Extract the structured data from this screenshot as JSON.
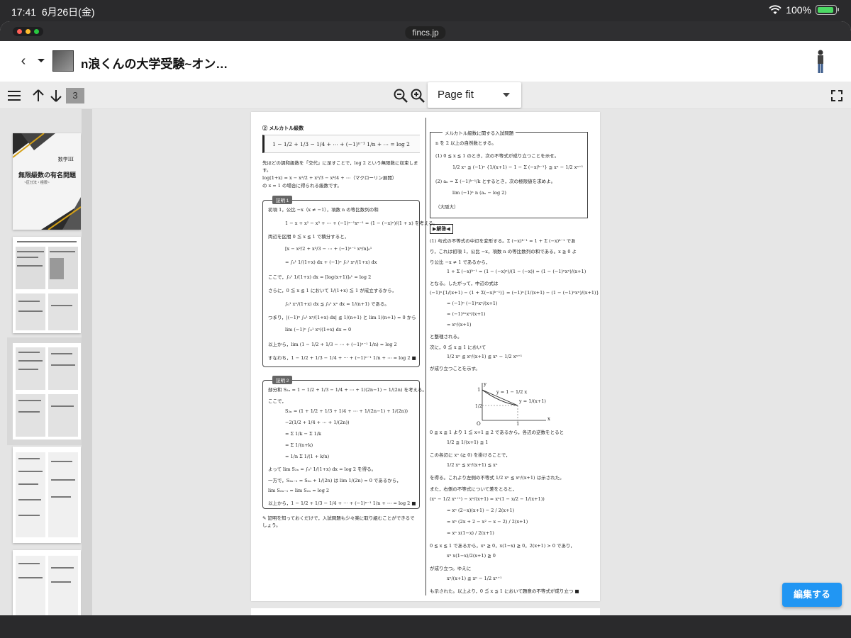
{
  "statusbar": {
    "time": "17:41",
    "date": "6月26日(金)",
    "battery": "100%",
    "battery_level": 1.0,
    "icons": [
      "wifi-icon",
      "battery-icon"
    ]
  },
  "browser": {
    "url": "fincs.jp",
    "traffic_colors": [
      "#ff5f57",
      "#febc2e",
      "#28c840"
    ]
  },
  "appbar": {
    "title": "n浪くんの大学受験~オン…",
    "icons": [
      "back-icon",
      "dropdown-icon",
      "document-thumbnail",
      "user-avatar-icon"
    ]
  },
  "toolbar": {
    "page_number": "3",
    "zoom": {
      "selected": "Page fit"
    },
    "icons": [
      "menu-icon",
      "arrow-up-icon",
      "arrow-down-icon",
      "zoom-out-icon",
      "zoom-in-icon",
      "fullscreen-icon"
    ]
  },
  "cover": {
    "subject": "数学III",
    "title": "無限級数の有名問題",
    "subtitle": "~区分法・極限~"
  },
  "page": {
    "sec_title": "② メルカトル級数",
    "main_formula": "1 − 1/2 + 1/3 − 1/4 + ⋯ + (−1)ⁿ⁻¹ 1/n + ⋯ = log 2",
    "intro_1": "先ほどの調和級数を「交代」に足すことで，log 2 という無限数に収束しま",
    "intro_2": "す。",
    "intro_3": "log(1+x) = x − x²/2 + x³/3 − x⁴/4 + ⋯（マクローリン展開）",
    "intro_4": "の x = 1 の場合に得られる級数です。",
    "proof1_tag": "証明 1",
    "proof1_lines": [
      "初項 1，公比 −x（x ≠ −1），項数 n の等比数列の和",
      "1 − x + x² − x³ + ⋯ + (−1)ⁿ⁻¹xⁿ⁻¹ = (1 − (−x)ⁿ)/(1 + x) を考える。",
      "両辺を区間 0 ≦ x ≦ 1 で積分すると，",
      "[x − x²/2 + x³/3 − ⋯ + (−1)ⁿ⁻¹ xⁿ/n]₀¹",
      "= ∫₀¹ 1/(1+x) dx + (−1)ⁿ ∫₀¹ xⁿ/(1+x) dx",
      "ここで，∫₀¹ 1/(1+x) dx = [log(x+1)]₀¹ = log 2",
      "さらに，0 ≦ x ≦ 1 において 1/(1+x) ≦ 1 が成立するから，",
      "∫₀¹ xⁿ/(1+x) dx ≦ ∫₀¹ xⁿ dx = 1/(n+1) である。",
      "つまり，|(−1)ⁿ ∫₀¹ xⁿ/(1+x) dx| ≦ 1/(n+1) と lim 1/(n+1) = 0 から",
      "lim (−1)ⁿ ∫₀¹ xⁿ/(1+x) dx = 0",
      "以上から，lim (1 − 1/2 + 1/3 − ⋯ + (−1)ⁿ⁻¹ 1/n) = log 2",
      "すなわち，1 − 1/2 + 1/3 − 1/4 + ⋯ + (−1)ⁿ⁻¹ 1/n + ⋯ = log 2 ■"
    ],
    "proof2_tag": "証明 2",
    "proof2_lines": [
      "部分和 S₂ₙ = 1 − 1/2 + 1/3 − 1/4 + ⋯ + 1/(2n−1) − 1/(2n) を考える。",
      "ここで，",
      "S₂ₙ = (1 + 1/2 + 1/3 + 1/4 + ⋯ + 1/(2n−1) + 1/(2n))",
      "−2(1/2 + 1/4 + ⋯ + 1/(2n))",
      "= Σ 1/k − Σ 1/k",
      "= Σ 1/(n+k)",
      "= 1/n Σ 1/(1 + k/n)",
      "よって lim S₂ₙ = ∫₀¹ 1/(1+x) dx = log 2 を得る。",
      "一方で，S₂ₙ₋₁ = S₂ₙ + 1/(2n) は lim 1/(2n) = 0 であるから，",
      "lim S₂ₙ₋₁ = lim S₂ₙ = log 2",
      "以上から，1 − 1/2 + 1/3 − 1/4 + ⋯ + (−1)ⁿ⁻¹ 1/n + ⋯ = log 2 ■"
    ],
    "footnote": "✎ 証明を知っておくだけで，入試問題も少々楽に取り組むことができるで",
    "footnote_2": "しょう。",
    "exam_title": "メルカトル級数に関する入試問題",
    "exam_lines": [
      "n を 2 以上の自然数とする。",
      "(1) 0 ≦ x ≦ 1 のとき，次の不等式が成り立つことを示せ。",
      "1/2 xⁿ ≦ (−1)ⁿ {1/(x+1) − 1 − Σ (−x)ᵏ⁻¹} ≦ xⁿ − 1/2 xⁿ⁺¹",
      "(2) aₙ = Σ (−1)ᵏ⁻¹/k とするとき，次の極限値を求めよ。",
      "lim (−1)ⁿ n (aₙ − log 2)",
      "（大阪大）"
    ],
    "answer_tag": "▶解答◀",
    "answer_lines": [
      "(1) 与式の不等式の中辺を変形する。Σ (−x)ᵏ⁻¹ = 1 + Σ (−x)ᵏ⁻¹ であ",
      "り，これは初項 1，公比 −x，項数 n の等比数列の和である。x ≧ 0 よ",
      "り公比 −x ≠ 1 であるから，",
      "1 + Σ (−x)ᵏ⁻¹ = (1 − (−x)ⁿ)/(1 − (−x)) = (1 − (−1)ⁿxⁿ)/(x+1)",
      "となる。したがって，中辺の式は",
      "(−1)ⁿ{1/(x+1) − (1 + Σ(−x)ᵏ⁻¹)} = (−1)ⁿ{1/(x+1) − (1 − (−1)ⁿxⁿ)/(x+1)}",
      "= (−1)ⁿ (−1)ⁿxⁿ/(x+1)",
      "= (−1)²ⁿxⁿ/(x+1)",
      "= xⁿ/(x+1)",
      "と整理される。",
      "次に，0 ≦ x ≦ 1 において",
      "1/2 xⁿ ≦ xⁿ/(x+1) ≦ xⁿ − 1/2 xⁿ⁺¹",
      "が成り立つことを示す。"
    ],
    "graph_labels": {
      "y": "y",
      "x": "x",
      "o": "O",
      "one_x": "1",
      "one_y": "1",
      "half": "1/2",
      "line": "y = 1 − 1/2 x",
      "curve": "y = 1/(x+1)"
    },
    "answer_lines_2": [
      "0 ≦ x ≦ 1 より 1 ≦ x+1 ≦ 2 であるから，各辺の逆数をとると",
      "1/2 ≦ 1/(x+1) ≦ 1",
      "この各辺に xⁿ (≧ 0) を掛けることで，",
      "1/2 xⁿ ≦ xⁿ/(x+1) ≦ xⁿ",
      "を得る。これより左側の不等式 1/2 xⁿ ≦ xⁿ/(x+1) は示された。",
      "また，右側の不等式について差をとると，",
      "(xⁿ − 1/2 xⁿ⁺¹) − xⁿ/(x+1) = xⁿ(1 − x/2 − 1/(x+1))",
      "= xⁿ (2−x)(x+1) − 2 / 2(x+1)",
      "= xⁿ (2x + 2 − x² − x − 2) / 2(x+1)",
      "= xⁿ x(1−x) / 2(x+1)",
      "0 ≦ x ≦ 1 であるから，xⁿ ≧ 0，x(1−x) ≧ 0，2(x+1) > 0 であり，",
      "xⁿ x(1−x)/2(x+1) ≧ 0",
      "が成り立つ。ゆえに",
      "xⁿ/(x+1) ≦ xⁿ − 1/2 xⁿ⁺¹",
      "も示された。以上より，0 ≦ x ≦ 1 において題意の不等式が成り立つ ■"
    ]
  },
  "edit_button": "編集する"
}
